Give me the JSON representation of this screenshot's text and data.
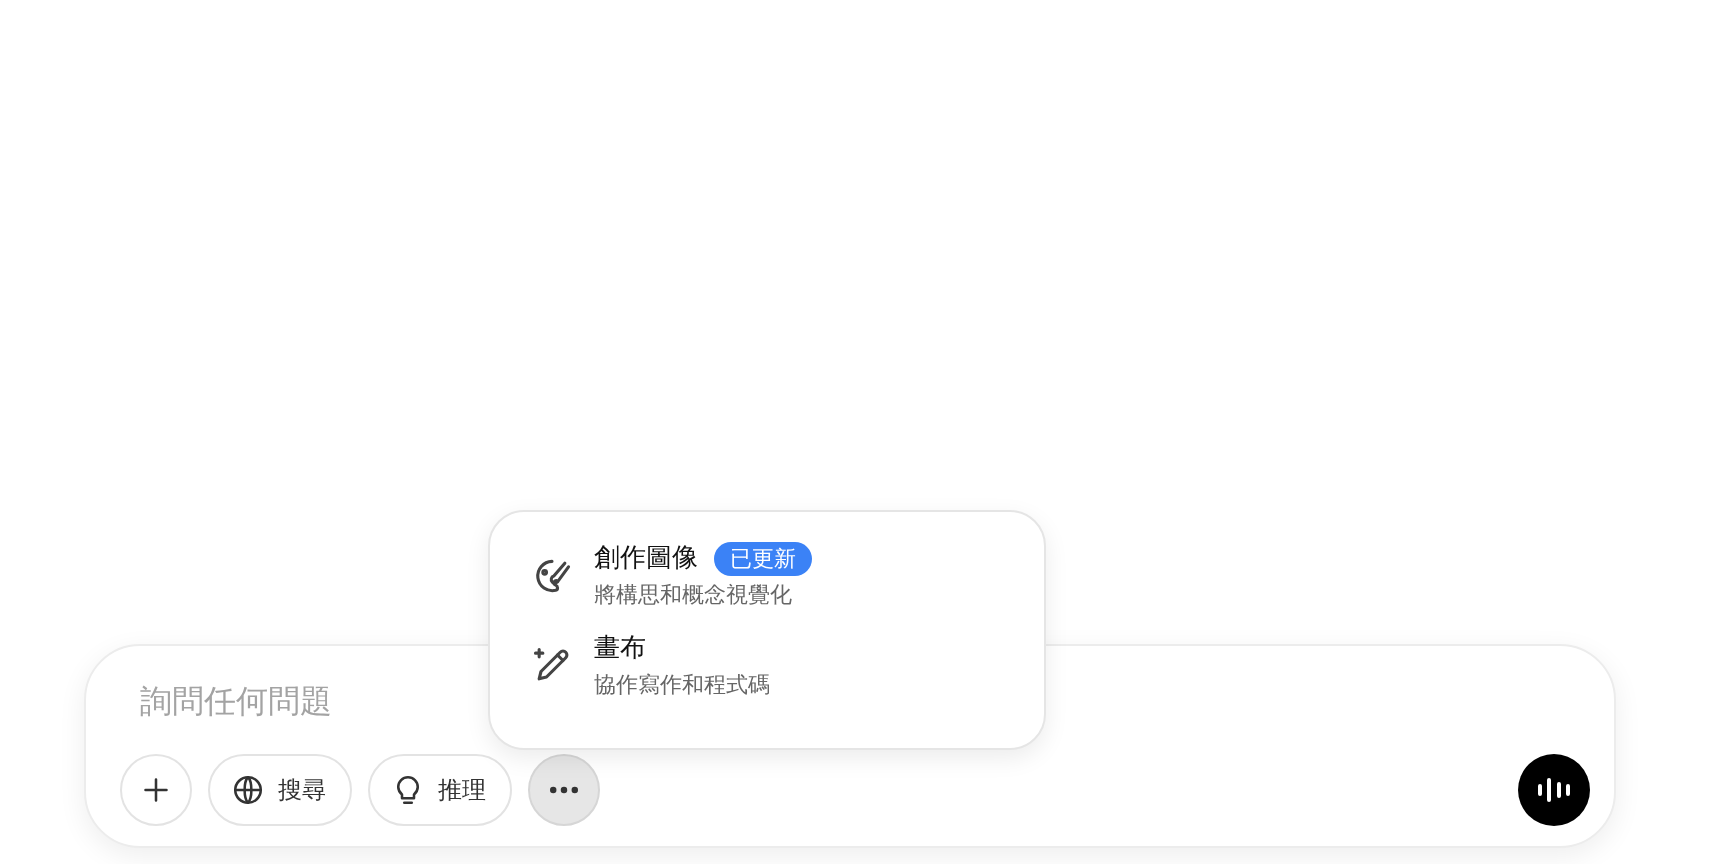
{
  "composer": {
    "placeholder": "詢問任何問題",
    "tools": [
      {
        "kind": "plus",
        "selected": false
      },
      {
        "kind": "globe",
        "label": "搜尋",
        "selected": false
      },
      {
        "kind": "bulb",
        "label": "推理",
        "selected": false
      },
      {
        "kind": "more",
        "selected": true
      }
    ]
  },
  "menu": {
    "items": [
      {
        "kind": "image",
        "title": "創作圖像",
        "badge": "已更新",
        "subtitle": "將構思和概念視覺化"
      },
      {
        "kind": "canvas",
        "title": "畫布",
        "subtitle": "協作寫作和程式碼"
      }
    ]
  }
}
